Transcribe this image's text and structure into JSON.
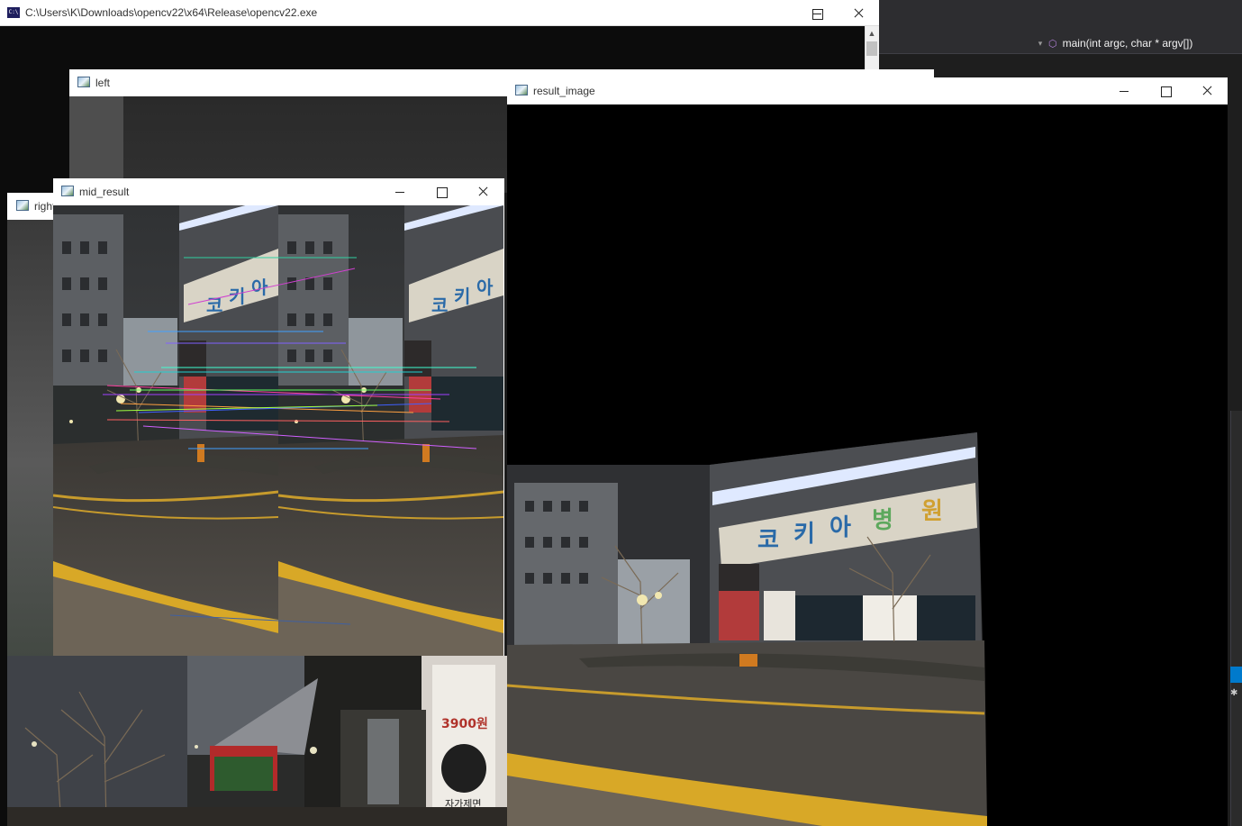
{
  "console": {
    "title": "C:\\Users\\K\\Downloads\\opencv22\\x64\\Release\\opencv22.exe",
    "icon_label": "C:\\"
  },
  "ide": {
    "method_signature": "main(int argc, char * argv[])",
    "method_icon": "method-cube-icon"
  },
  "windows": {
    "left": {
      "title": "left"
    },
    "right": {
      "title": "right"
    },
    "mid_result": {
      "title": "mid_result"
    },
    "result_image": {
      "title": "result_image"
    }
  },
  "caption_buttons": {
    "minimize": "minimize",
    "maximize": "maximize",
    "close": "close"
  },
  "signs": {
    "korean_letters": [
      "코",
      "키",
      "아",
      "병",
      "원"
    ],
    "shop_sign": [
      "3900원",
      "자가제면"
    ]
  },
  "colors": {
    "console_bg": "#0c0c0c",
    "ide_bg": "#1e1e1e",
    "ide_accent": "#007acc",
    "road_line": "#e0b030"
  }
}
